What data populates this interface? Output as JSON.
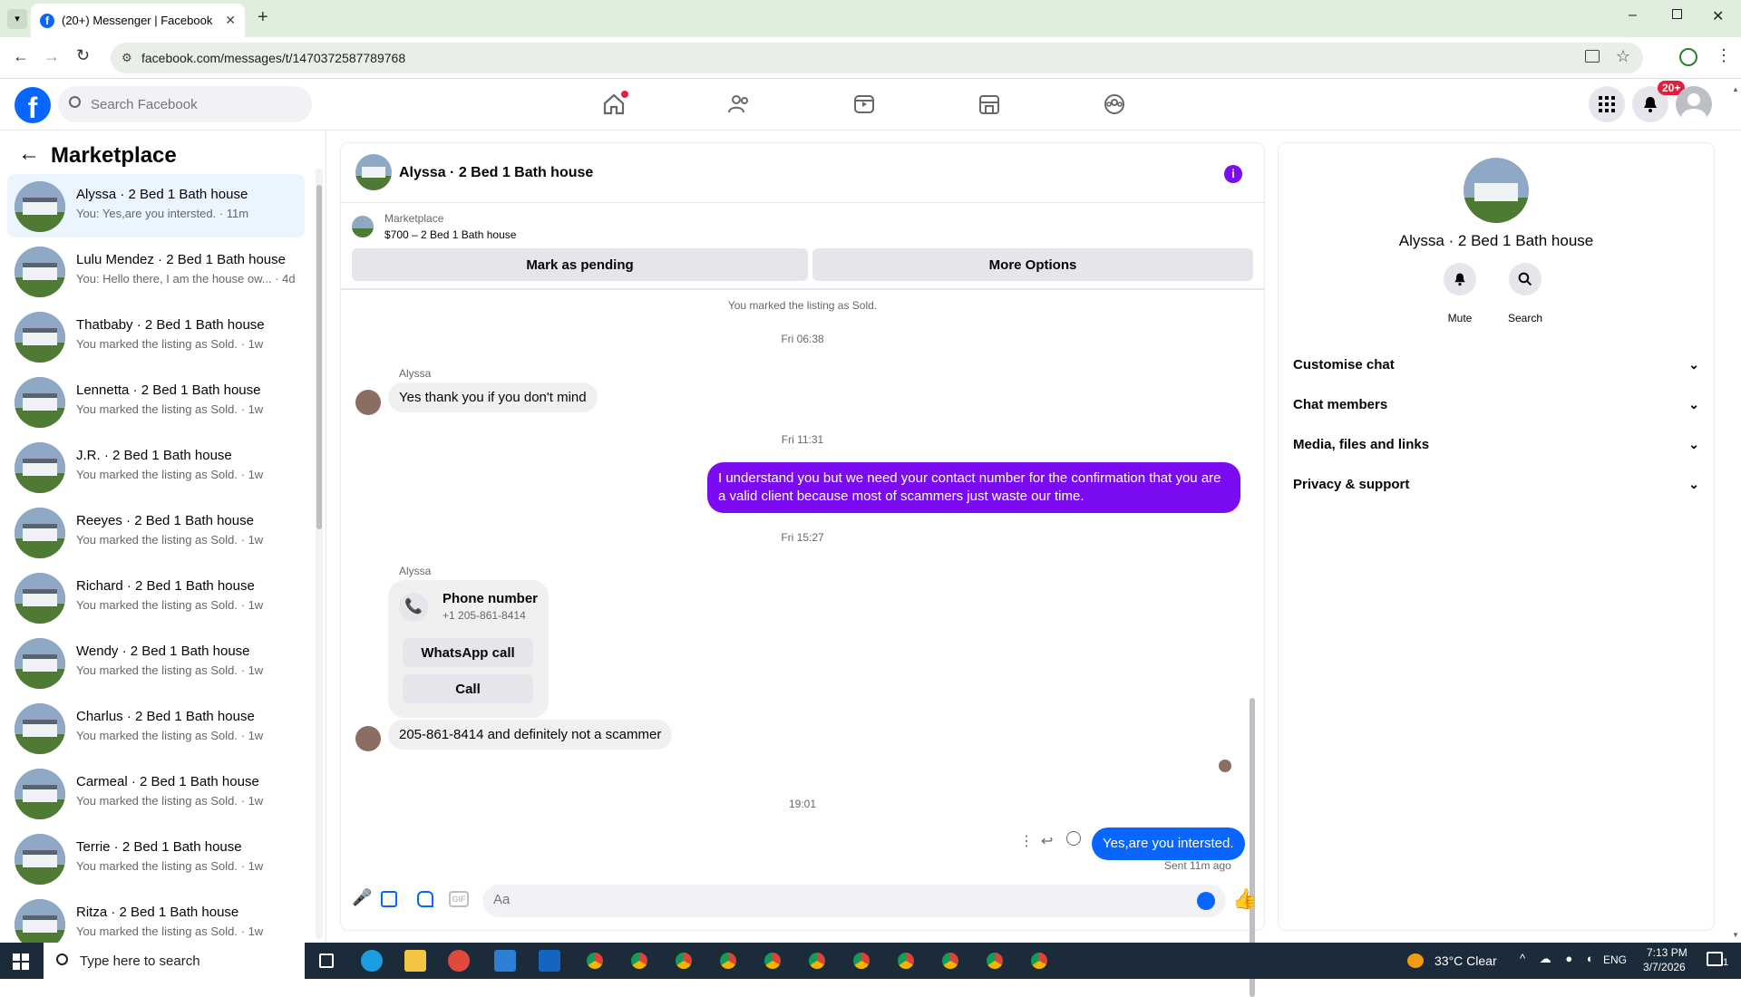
{
  "browser": {
    "tab_title": "(20+) Messenger | Facebook",
    "url": "facebook.com/messages/t/1470372587789768"
  },
  "fb_header": {
    "search_placeholder": "Search Facebook",
    "notification_badge": "20+"
  },
  "sidebar": {
    "title": "Marketplace",
    "conversations": [
      {
        "name": "Alyssa · 2 Bed 1 Bath house",
        "preview": "You: Yes,are you intersted. · 11m",
        "active": true
      },
      {
        "name": "Lulu Mendez · 2 Bed 1 Bath house",
        "preview": "You: Hello there, I am the house ow... · 4d",
        "active": false
      },
      {
        "name": "Thatbaby · 2 Bed 1 Bath house",
        "preview": "You marked the listing as Sold. · 1w",
        "active": false
      },
      {
        "name": "Lennetta · 2 Bed 1 Bath house",
        "preview": "You marked the listing as Sold. · 1w",
        "active": false
      },
      {
        "name": "J.R. · 2 Bed 1 Bath house",
        "preview": "You marked the listing as Sold. · 1w",
        "active": false
      },
      {
        "name": "Reeyes · 2 Bed 1 Bath house",
        "preview": "You marked the listing as Sold. · 1w",
        "active": false
      },
      {
        "name": "Richard · 2 Bed 1 Bath house",
        "preview": "You marked the listing as Sold. · 1w",
        "active": false
      },
      {
        "name": "Wendy · 2 Bed 1 Bath house",
        "preview": "You marked the listing as Sold. · 1w",
        "active": false
      },
      {
        "name": "Charlus · 2 Bed 1 Bath house",
        "preview": "You marked the listing as Sold. · 1w",
        "active": false
      },
      {
        "name": "Carmeal · 2 Bed 1 Bath house",
        "preview": "You marked the listing as Sold. · 1w",
        "active": false
      },
      {
        "name": "Terrie · 2 Bed 1 Bath house",
        "preview": "You marked the listing as Sold. · 1w",
        "active": false
      },
      {
        "name": "Ritza · 2 Bed 1 Bath house",
        "preview": "You marked the listing as Sold. · 1w",
        "active": false
      }
    ]
  },
  "chat": {
    "title": "Alyssa · 2 Bed 1 Bath house",
    "listing_label": "Marketplace",
    "listing_price": "$700 – 2 Bed 1 Bath house",
    "mark_pending": "Mark as pending",
    "more_options": "More Options",
    "sold_notice": "You marked the listing as Sold.",
    "ts1": "Fri 06:38",
    "sender1": "Alyssa",
    "msg1": "Yes thank you if you don't mind",
    "ts2": "Fri 11:31",
    "msg2": "I  understand you  but we need your contact number for the confirmation that you are a valid client because most of scammers just waste our time.",
    "ts3": "Fri 15:27",
    "sender2": "Alyssa",
    "phone_title": "Phone number",
    "phone_number": "+1 205-861-8414",
    "whatsapp_call": "WhatsApp call",
    "call": "Call",
    "msg3": "205-861-8414 and definitely not a scammer",
    "ts4": "19:01",
    "msg4": "Yes,are you intersted.",
    "sent_status": "Sent 11m ago",
    "composer_placeholder": "Aa"
  },
  "info_panel": {
    "title": "Alyssa · 2 Bed 1 Bath house",
    "mute": "Mute",
    "search": "Search",
    "sections": [
      "Customise chat",
      "Chat members",
      "Media, files and links",
      "Privacy & support"
    ]
  },
  "taskbar": {
    "search_placeholder": "Type here to search",
    "weather": "33°C  Clear",
    "lang": "ENG",
    "time": "7:13 PM",
    "date": "3/7/2026",
    "notif_count": "1"
  },
  "colors": {
    "fb_blue": "#0866ff",
    "purple": "#7b0cf2",
    "badge_red": "#e41e3f"
  }
}
